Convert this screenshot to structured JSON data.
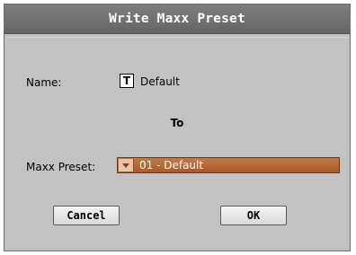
{
  "dialog": {
    "title": "Write Maxx Preset",
    "name_label": "Name:",
    "name_icon_glyph": "T",
    "name_icon": "text-edit-icon",
    "name_value": "Default",
    "to_label": "To",
    "preset_label": "Maxx Preset:",
    "preset_value": "01 - Default",
    "cancel_label": "Cancel",
    "ok_label": "OK"
  },
  "colors": {
    "title_bar": "#6e6e6e",
    "panel": "#c2c2c2",
    "select_accent": "#b8693a"
  }
}
